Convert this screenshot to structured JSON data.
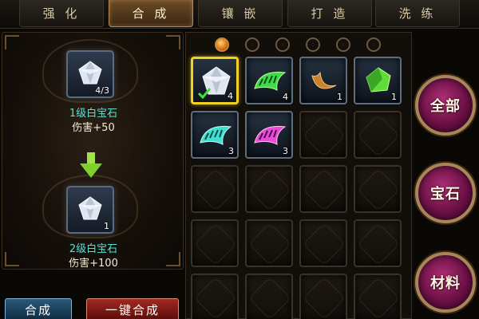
{
  "tabs": [
    {
      "label": "强 化",
      "active": false
    },
    {
      "label": "合 成",
      "active": true
    },
    {
      "label": "镶 嵌",
      "active": false
    },
    {
      "label": "打 造",
      "active": false
    },
    {
      "label": "洗 练",
      "active": false
    }
  ],
  "synthesis": {
    "source": {
      "count": "4/3",
      "name": "1级白宝石",
      "attr": "伤害+50"
    },
    "result": {
      "count": "1",
      "name": "2级白宝石",
      "attr": "伤害+100"
    }
  },
  "pagination": {
    "pages": 6,
    "current_page": 1
  },
  "inventory": {
    "items": [
      {
        "icon": "white-gem-icon",
        "count": "4",
        "selected": true
      },
      {
        "icon": "green-beast-tooth-icon",
        "count": "4",
        "selected": false
      },
      {
        "icon": "crescent-moon-icon",
        "count": "1",
        "selected": false
      },
      {
        "icon": "green-gem-icon",
        "count": "1",
        "selected": false
      },
      {
        "icon": "cyan-beast-tooth-icon",
        "count": "3",
        "selected": false
      },
      {
        "icon": "pink-beast-tooth-icon",
        "count": "3",
        "selected": false
      }
    ]
  },
  "categories": [
    {
      "label": "全部"
    },
    {
      "label": "宝石"
    },
    {
      "label": "材料"
    }
  ],
  "buttons": {
    "compose": "合成",
    "one_key": "一键合成"
  },
  "colors": {
    "gem_name": "#59e0d4",
    "tab_active": "#6b4a26",
    "selection": "#f2d21e"
  }
}
